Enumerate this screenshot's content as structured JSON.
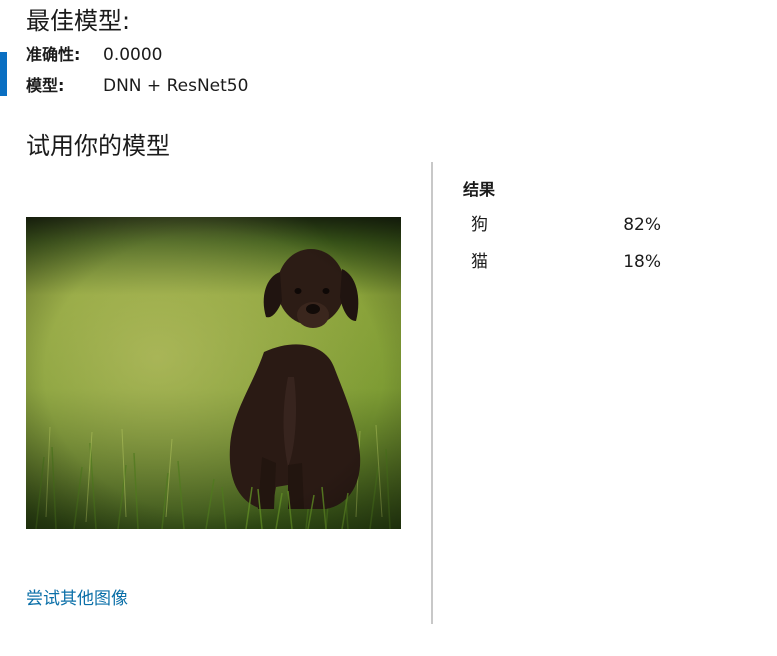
{
  "best_model": {
    "title": "最佳模型:",
    "accuracy_label": "准确性:",
    "accuracy_value": "0.0000",
    "model_label": "模型:",
    "model_value": "DNN + ResNet50"
  },
  "try_model": {
    "title": "试用你的模型",
    "image_subject": "puppy-on-grass",
    "try_other_link": "尝试其他图像"
  },
  "results": {
    "title": "结果",
    "rows": [
      {
        "label": "狗",
        "value": "82%"
      },
      {
        "label": "猫",
        "value": "18%"
      }
    ]
  },
  "colors": {
    "accent": "#0a6fc2",
    "link": "#0a6fa8",
    "divider": "#c8c8c8"
  }
}
